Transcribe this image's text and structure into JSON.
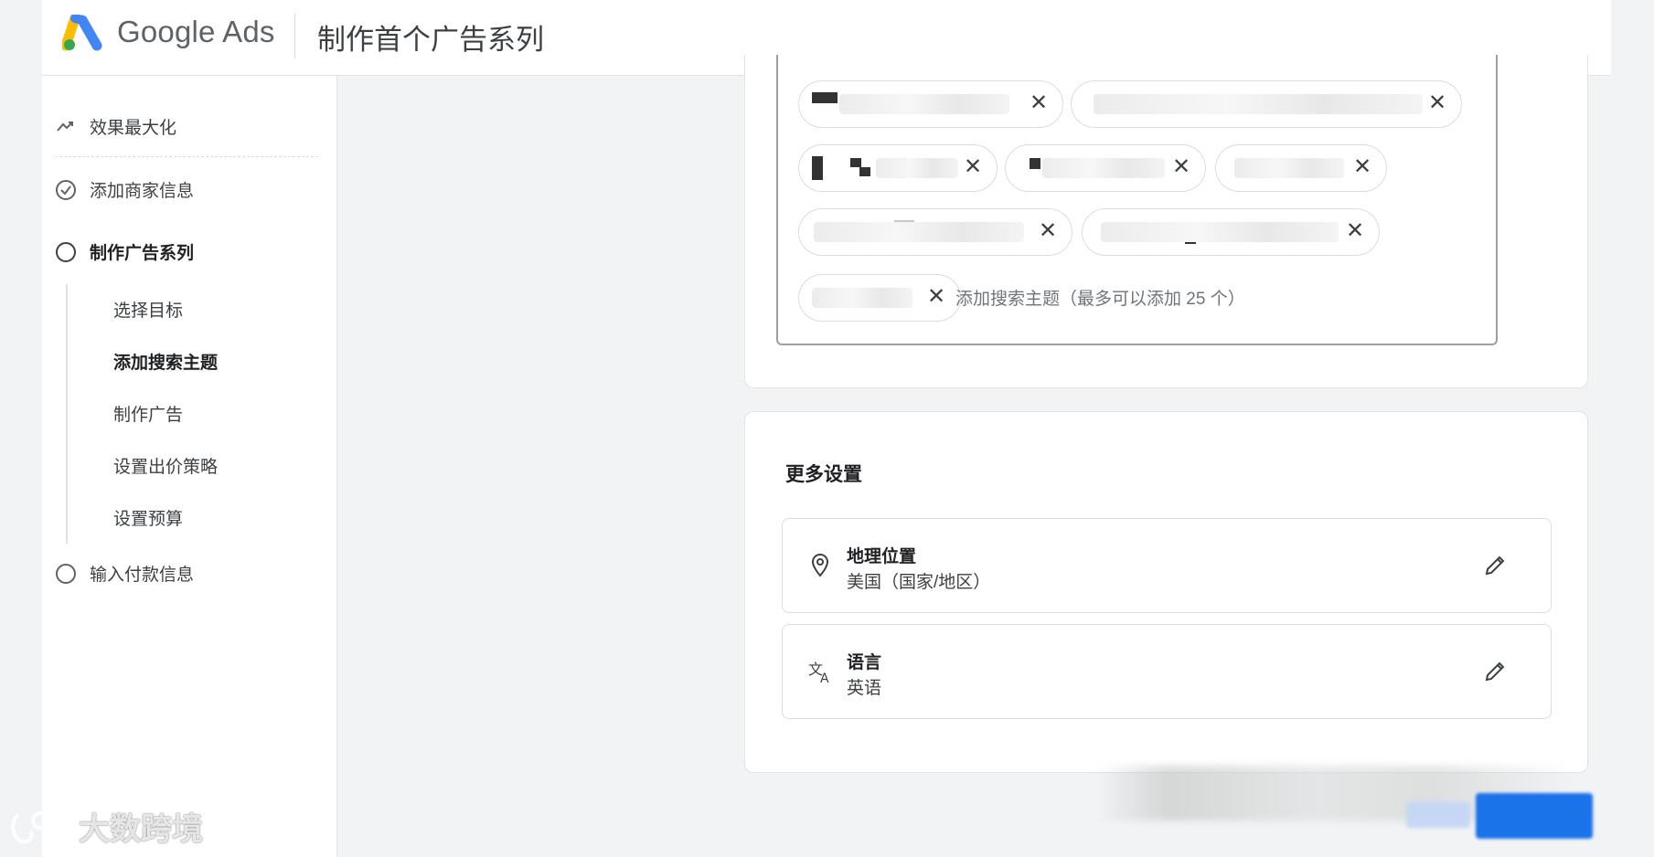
{
  "header": {
    "brand_name": "Google Ads",
    "title": "制作首个广告系列"
  },
  "sidebar": {
    "items": [
      {
        "label": "效果最大化",
        "icon": "trend-icon",
        "state": "none"
      },
      {
        "label": "添加商家信息",
        "icon": "check-circle-icon",
        "state": "done"
      },
      {
        "label": "制作广告系列",
        "icon": "circle-icon",
        "state": "current"
      },
      {
        "label": "输入付款信息",
        "icon": "circle-icon",
        "state": "todo"
      }
    ],
    "sub_items": [
      {
        "label": "选择目标",
        "active": false
      },
      {
        "label": "添加搜索主题",
        "active": true
      },
      {
        "label": "制作广告",
        "active": false
      },
      {
        "label": "设置出价策略",
        "active": false
      },
      {
        "label": "设置预算",
        "active": false
      }
    ]
  },
  "search_topics": {
    "add_placeholder": "添加搜索主题（最多可以添加 25 个）",
    "remove_icon": "close-icon",
    "chip_count_visible": 8
  },
  "more_settings": {
    "title": "更多设置",
    "location": {
      "label": "地理位置",
      "value": "美国（国家/地区）",
      "icon": "location-pin-icon"
    },
    "language": {
      "label": "语言",
      "value": "英语",
      "icon": "translate-icon"
    },
    "edit_icon": "pencil-icon"
  },
  "watermark": {
    "text": "大数跨境"
  },
  "colors": {
    "primary_blue": "#1a73e8",
    "page_bg": "#f1f3f4",
    "card_bg": "#ffffff",
    "text_primary": "#202124",
    "text_secondary": "#3c4043"
  }
}
